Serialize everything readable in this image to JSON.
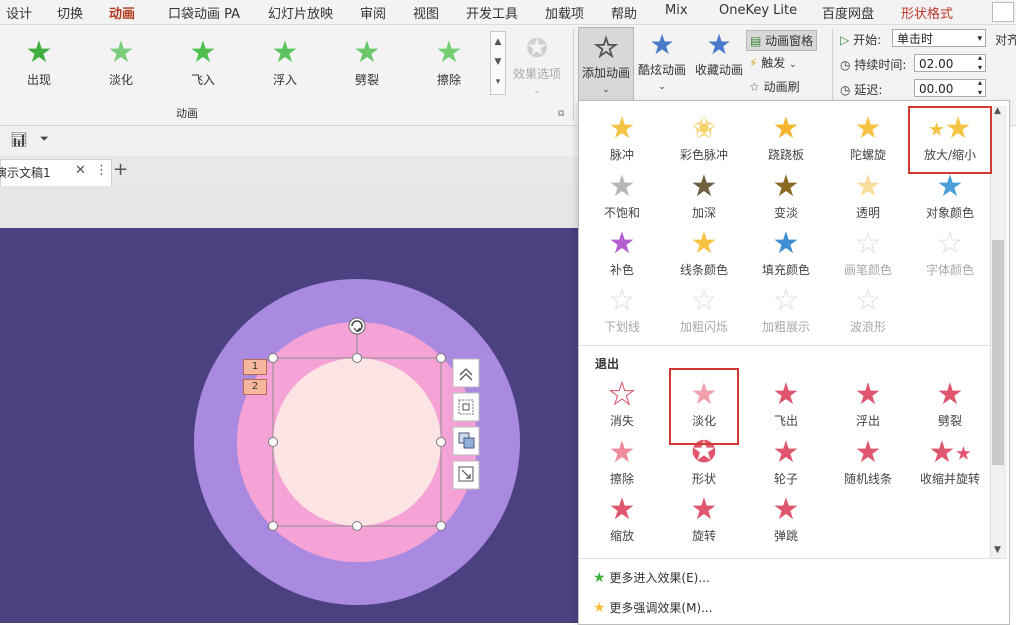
{
  "menubar": {
    "items": [
      "设计",
      "切换",
      "动画",
      "口袋动画 PA",
      "幻灯片放映",
      "审阅",
      "视图",
      "开发工具",
      "加载项",
      "帮助",
      "Mix",
      "OneKey Lite",
      "百度网盘",
      "形状格式"
    ]
  },
  "ribbon": {
    "gallery": [
      "出现",
      "淡化",
      "飞入",
      "浮入",
      "劈裂",
      "擦除"
    ],
    "effect_options": "效果选项",
    "group_label": "动画",
    "add_animation": "添加动画",
    "cool_animation": "酷炫动画",
    "fav_animation": "收藏动画",
    "anim_pane": "动画窗格",
    "trigger": "触发",
    "anim_painter": "动画刷",
    "start_label": "开始:",
    "start_value": "单击时",
    "duration_label": "持续时间:",
    "duration_value": "02.00",
    "delay_label": "延迟:",
    "delay_value": "00.00",
    "align_label": "对齐"
  },
  "doc": {
    "tab_title": "演示文稿1",
    "add_tab": "+"
  },
  "slide": {
    "badges": [
      "1",
      "2"
    ]
  },
  "panel": {
    "emphasis": [
      "脉冲",
      "彩色脉冲",
      "跷跷板",
      "陀螺旋",
      "放大/缩小",
      "不饱和",
      "加深",
      "变淡",
      "透明",
      "对象颜色",
      "补色",
      "线条颜色",
      "填充颜色",
      "画笔颜色",
      "字体颜色",
      "下划线",
      "加粗闪烁",
      "加粗展示",
      "波浪形"
    ],
    "exit_title": "退出",
    "exit": [
      "消失",
      "淡化",
      "飞出",
      "浮出",
      "劈裂",
      "擦除",
      "形状",
      "轮子",
      "随机线条",
      "收缩并旋转",
      "缩放",
      "旋转",
      "弹跳"
    ],
    "more_entrance": "更多进入效果(E)...",
    "more_emphasis": "更多强调效果(M)..."
  },
  "colors": {
    "slide_bg": "#4b4080",
    "outer_circle": "#a98ae0",
    "mid_circle": "#f5a3d6",
    "inner_circle": "#fde4e4",
    "accent": "#b33a1f",
    "highlight_box": "#d23a3a"
  }
}
